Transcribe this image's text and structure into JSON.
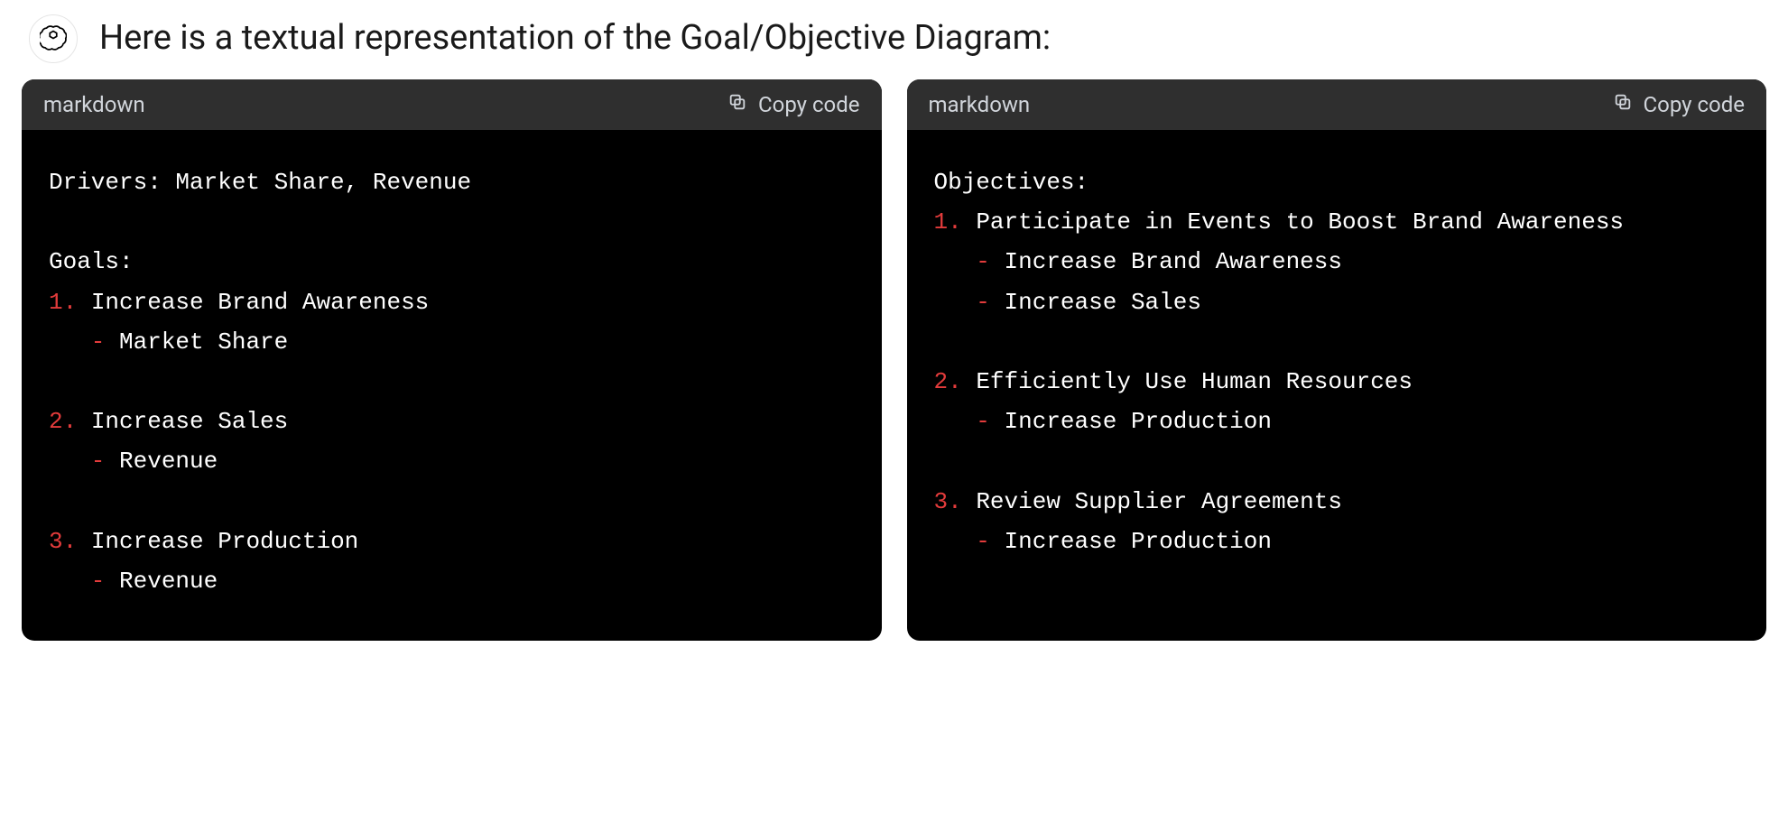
{
  "intro": "Here is a textual representation of the Goal/Objective Diagram:",
  "blocks": [
    {
      "lang": "markdown",
      "copy": "Copy code",
      "lines": [
        {
          "plain": "Drivers: Market Share, Revenue"
        },
        {
          "plain": ""
        },
        {
          "plain": "Goals:"
        },
        {
          "num": "1.",
          "text": " Increase Brand Awareness"
        },
        {
          "dash": "   -",
          "text": " Market Share"
        },
        {
          "plain": ""
        },
        {
          "num": "2.",
          "text": " Increase Sales"
        },
        {
          "dash": "   -",
          "text": " Revenue"
        },
        {
          "plain": ""
        },
        {
          "num": "3.",
          "text": " Increase Production"
        },
        {
          "dash": "   -",
          "text": " Revenue"
        }
      ]
    },
    {
      "lang": "markdown",
      "copy": "Copy code",
      "lines": [
        {
          "plain": "Objectives:"
        },
        {
          "num": "1.",
          "text": " Participate in Events to Boost Brand Awareness"
        },
        {
          "dash": "   -",
          "text": " Increase Brand Awareness"
        },
        {
          "dash": "   -",
          "text": " Increase Sales"
        },
        {
          "plain": ""
        },
        {
          "num": "2.",
          "text": " Efficiently Use Human Resources"
        },
        {
          "dash": "   -",
          "text": " Increase Production"
        },
        {
          "plain": ""
        },
        {
          "num": "3.",
          "text": " Review Supplier Agreements"
        },
        {
          "dash": "   -",
          "text": " Increase Production"
        }
      ]
    }
  ]
}
